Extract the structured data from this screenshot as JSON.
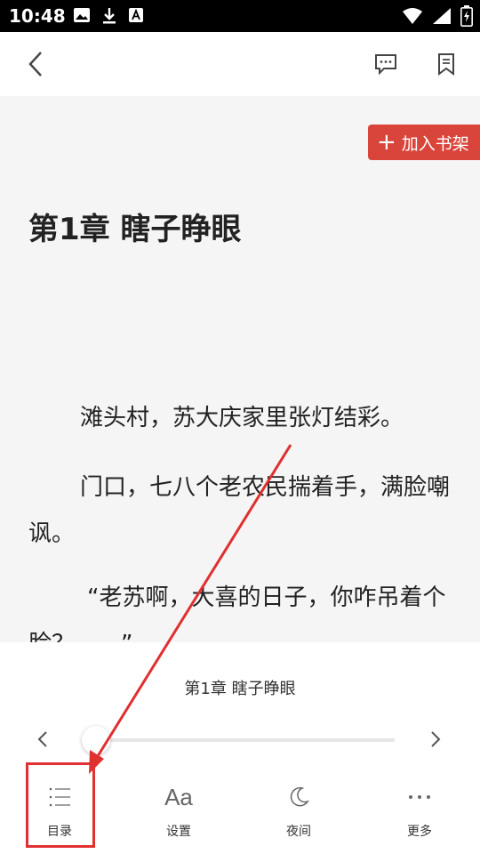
{
  "status": {
    "time": "10:48"
  },
  "reader": {
    "add_to_shelf": "加入书架",
    "chapter_heading": "第1章 瞎子睁眼",
    "paragraphs": [
      "滩头村，苏大庆家里张灯结彩。",
      "门口，七八个老农民揣着手，满脸嘲讽。",
      "“老苏啊，大喜的日子，你咋吊着个脸？……”"
    ]
  },
  "panel": {
    "chapter_title": "第1章 瞎子睁眼",
    "progress": 0,
    "toolbar": {
      "catalog": "目录",
      "settings": "设置",
      "settings_icon_text": "Aa",
      "night": "夜间",
      "more": "更多"
    }
  },
  "colors": {
    "accent": "#d9453a",
    "annotation": "#e03030"
  }
}
